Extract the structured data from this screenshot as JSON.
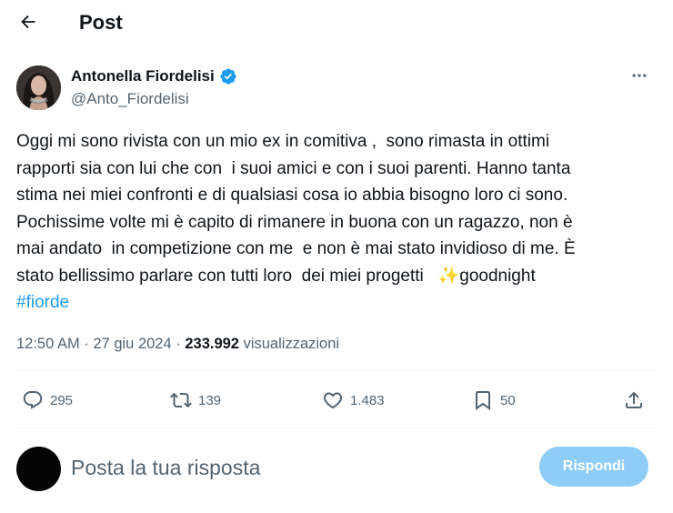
{
  "header": {
    "title": "Post",
    "back_icon": "arrow-left-icon"
  },
  "author": {
    "name": "Antonella Fiordelisi",
    "handle": "@Anto_Fiordelisi",
    "verified": true,
    "verified_color": "#1d9bf0"
  },
  "tweet": {
    "lines": [
      "Oggi mi sono rivista con un mio ex in comitiva ,  sono rimasta in ottimi",
      "rapporti sia con lui che con  i suoi amici e con i suoi parenti. Hanno tanta",
      "stima nei miei confronti e di qualsiasi cosa io abbia bisogno loro ci sono.",
      "Pochissime volte mi è capito di rimanere in buona con un ragazzo, non è",
      "mai andato  in competizione con me  e non è mai stato invidioso di me. È",
      "stato bellissimo parlare con tutti loro  dei miei progetti   ✨goodnight"
    ],
    "hashtag": "#fiorde",
    "hashtag_color": "#1d9bf0"
  },
  "meta": {
    "time": "12:50 AM",
    "separator": "·",
    "date": "27 giu 2024",
    "views_count": "233.992",
    "views_label": "visualizzazioni"
  },
  "actions": {
    "replies": "295",
    "reposts": "139",
    "likes": "1.483",
    "bookmarks": "50"
  },
  "reply_box": {
    "placeholder": "Posta la tua risposta",
    "button_label": "Rispondi",
    "button_color": "#8ecdf8"
  }
}
